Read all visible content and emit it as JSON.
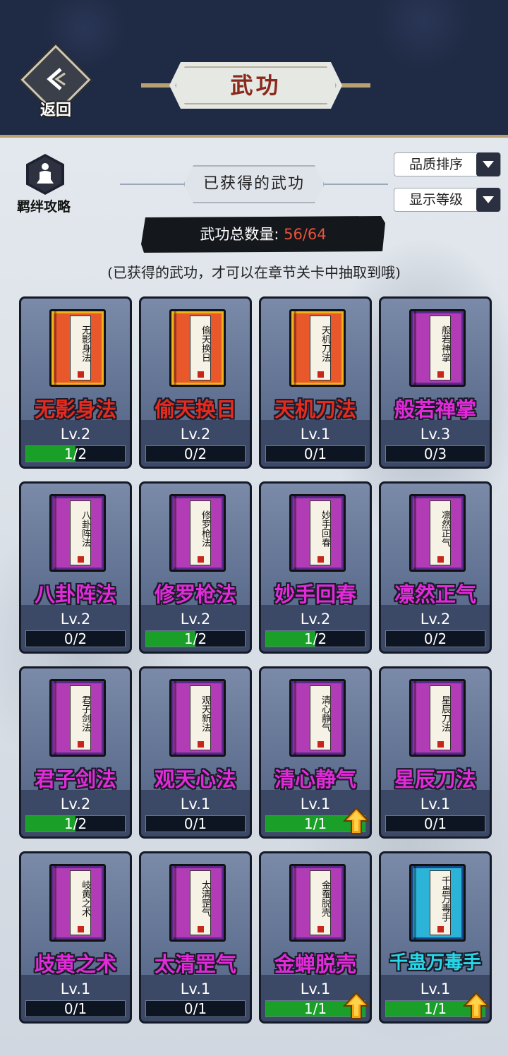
{
  "header": {
    "back_label": "返回",
    "title": "武功"
  },
  "guide": {
    "label": "羁绊攻略"
  },
  "section_title": "已获得的武功",
  "sort": {
    "quality_label": "品质排序",
    "level_label": "显示等级"
  },
  "count": {
    "label": "武功总数量:",
    "value": "56/64"
  },
  "hint": "(已获得的武功，才可以在章节关卡中抽取到哦)",
  "colors": {
    "orange_book": "#e8582a",
    "purple_book": "#b23bb6",
    "cyan_book": "#2bb4d8",
    "red_name": "#e52b1e",
    "purple_name": "#e12ad8",
    "cyan_name": "#27d8e8",
    "progress_green": "#1aa028"
  },
  "skills": [
    {
      "name": "无影身法",
      "book": "无影身法",
      "rarity": "orange",
      "level": "Lv.2",
      "progress": "1/2",
      "fill": 0.5,
      "upgrade": false
    },
    {
      "name": "偷天换日",
      "book": "偷天换日",
      "rarity": "orange",
      "level": "Lv.2",
      "progress": "0/2",
      "fill": 0,
      "upgrade": false
    },
    {
      "name": "天机刀法",
      "book": "天机刀法",
      "rarity": "orange",
      "level": "Lv.1",
      "progress": "0/1",
      "fill": 0,
      "upgrade": false
    },
    {
      "name": "般若禅掌",
      "book": "般若神掌",
      "rarity": "purple",
      "level": "Lv.3",
      "progress": "0/3",
      "fill": 0,
      "upgrade": false
    },
    {
      "name": "八卦阵法",
      "book": "八卦阵法",
      "rarity": "purple",
      "level": "Lv.2",
      "progress": "0/2",
      "fill": 0,
      "upgrade": false
    },
    {
      "name": "修罗枪法",
      "book": "修罗枪法",
      "rarity": "purple",
      "level": "Lv.2",
      "progress": "1/2",
      "fill": 0.5,
      "upgrade": false
    },
    {
      "name": "妙手回春",
      "book": "妙手回春",
      "rarity": "purple",
      "level": "Lv.2",
      "progress": "1/2",
      "fill": 0.5,
      "upgrade": false
    },
    {
      "name": "凛然正气",
      "book": "凛然正气",
      "rarity": "purple",
      "level": "Lv.2",
      "progress": "0/2",
      "fill": 0,
      "upgrade": false
    },
    {
      "name": "君子剑法",
      "book": "君子剑法",
      "rarity": "purple",
      "level": "Lv.2",
      "progress": "1/2",
      "fill": 0.5,
      "upgrade": false
    },
    {
      "name": "观天心法",
      "book": "观天新法",
      "rarity": "purple",
      "level": "Lv.1",
      "progress": "0/1",
      "fill": 0,
      "upgrade": false
    },
    {
      "name": "清心静气",
      "book": "清心静气",
      "rarity": "purple",
      "level": "Lv.1",
      "progress": "1/1",
      "fill": 1,
      "upgrade": true
    },
    {
      "name": "星辰刀法",
      "book": "星辰刀法",
      "rarity": "purple",
      "level": "Lv.1",
      "progress": "0/1",
      "fill": 0,
      "upgrade": false
    },
    {
      "name": "歧黄之术",
      "book": "岐黄之术",
      "rarity": "purple",
      "level": "Lv.1",
      "progress": "0/1",
      "fill": 0,
      "upgrade": false
    },
    {
      "name": "太清罡气",
      "book": "太清罡气",
      "rarity": "purple",
      "level": "Lv.1",
      "progress": "0/1",
      "fill": 0,
      "upgrade": false
    },
    {
      "name": "金蝉脱壳",
      "book": "金蚕脱壳",
      "rarity": "purple",
      "level": "Lv.1",
      "progress": "1/1",
      "fill": 1,
      "upgrade": true
    },
    {
      "name": "千蛊万毒手",
      "book": "千蛊万毒手",
      "rarity": "cyan",
      "level": "Lv.1",
      "progress": "1/1",
      "fill": 1,
      "upgrade": true
    }
  ]
}
